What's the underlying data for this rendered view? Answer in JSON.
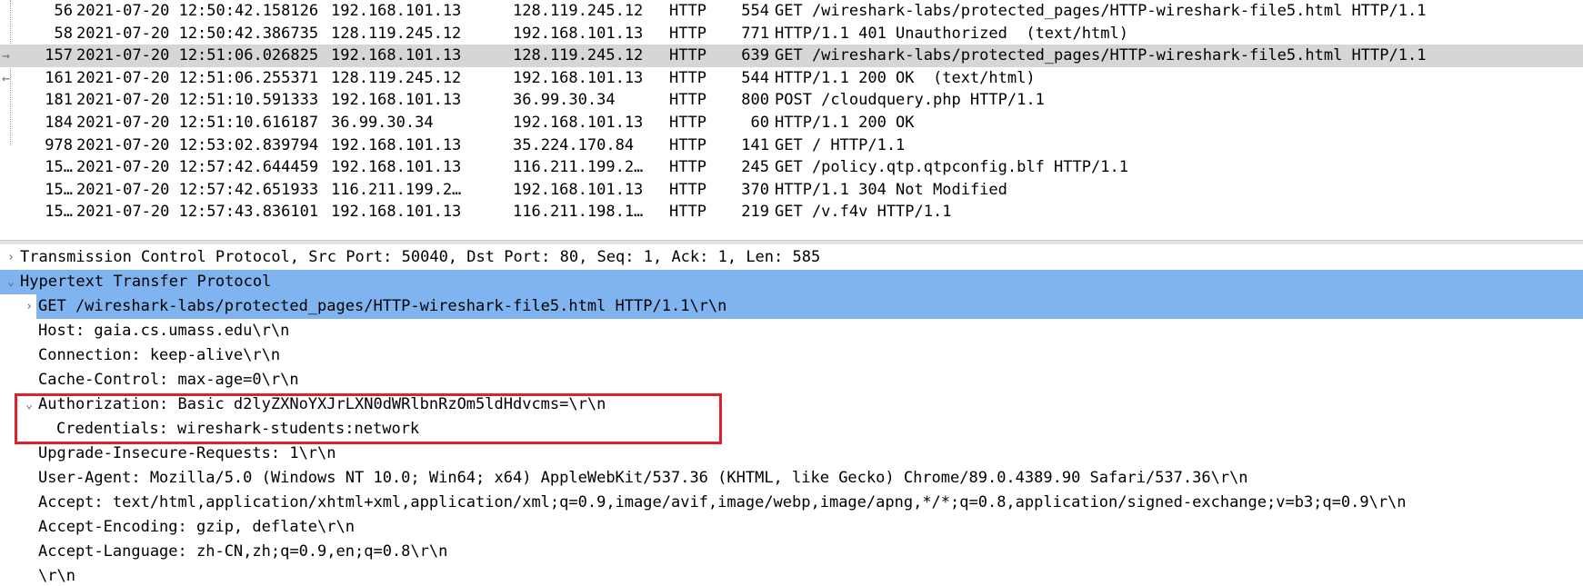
{
  "packet_list": {
    "rows": [
      {
        "no": "56",
        "time": "2021-07-20 12:50:42.158126",
        "src": "192.168.101.13",
        "dst": "128.119.245.12",
        "proto": "HTTP",
        "len": "554",
        "info": "GET /wireshark-labs/protected_pages/HTTP-wireshark-file5.html HTTP/1.1"
      },
      {
        "no": "58",
        "time": "2021-07-20 12:50:42.386735",
        "src": "128.119.245.12",
        "dst": "192.168.101.13",
        "proto": "HTTP",
        "len": "771",
        "info": "HTTP/1.1 401 Unauthorized  (text/html)"
      },
      {
        "no": "157",
        "time": "2021-07-20 12:51:06.026825",
        "src": "192.168.101.13",
        "dst": "128.119.245.12",
        "proto": "HTTP",
        "len": "639",
        "info": "GET /wireshark-labs/protected_pages/HTTP-wireshark-file5.html HTTP/1.1"
      },
      {
        "no": "161",
        "time": "2021-07-20 12:51:06.255371",
        "src": "128.119.245.12",
        "dst": "192.168.101.13",
        "proto": "HTTP",
        "len": "544",
        "info": "HTTP/1.1 200 OK  (text/html)"
      },
      {
        "no": "181",
        "time": "2021-07-20 12:51:10.591333",
        "src": "192.168.101.13",
        "dst": "36.99.30.34",
        "proto": "HTTP",
        "len": "800",
        "info": "POST /cloudquery.php HTTP/1.1"
      },
      {
        "no": "184",
        "time": "2021-07-20 12:51:10.616187",
        "src": "36.99.30.34",
        "dst": "192.168.101.13",
        "proto": "HTTP",
        "len": "60",
        "info": "HTTP/1.1 200 OK"
      },
      {
        "no": "978",
        "time": "2021-07-20 12:53:02.839794",
        "src": "192.168.101.13",
        "dst": "35.224.170.84",
        "proto": "HTTP",
        "len": "141",
        "info": "GET / HTTP/1.1"
      },
      {
        "no": "15…",
        "time": "2021-07-20 12:57:42.644459",
        "src": "192.168.101.13",
        "dst": "116.211.199.2…",
        "proto": "HTTP",
        "len": "245",
        "info": "GET /policy.qtp.qtpconfig.blf HTTP/1.1"
      },
      {
        "no": "15…",
        "time": "2021-07-20 12:57:42.651933",
        "src": "116.211.199.2…",
        "dst": "192.168.101.13",
        "proto": "HTTP",
        "len": "370",
        "info": "HTTP/1.1 304 Not Modified"
      },
      {
        "no": "15…",
        "time": "2021-07-20 12:57:43.836101",
        "src": "192.168.101.13",
        "dst": "116.211.198.1…",
        "proto": "HTTP",
        "len": "219",
        "info": "GET /v.f4v HTTP/1.1"
      }
    ],
    "selected_index": 2
  },
  "details": {
    "rows": [
      {
        "expander": "›",
        "text": "Transmission Control Protocol, Src Port: 50040, Dst Port: 80, Seq: 1, Ack: 1, Len: 585"
      },
      {
        "expander": "⌄",
        "text": "Hypertext Transfer Protocol"
      },
      {
        "expander": "›",
        "text": "GET /wireshark-labs/protected_pages/HTTP-wireshark-file5.html HTTP/1.1\\r\\n"
      },
      {
        "expander": "",
        "text": "Host: gaia.cs.umass.edu\\r\\n"
      },
      {
        "expander": "",
        "text": "Connection: keep-alive\\r\\n"
      },
      {
        "expander": "",
        "text": "Cache-Control: max-age=0\\r\\n"
      },
      {
        "expander": "⌄",
        "text": "Authorization: Basic d2lyZXNoYXJrLXN0dWRlbnRzOm5ldHdvcms=\\r\\n"
      },
      {
        "expander": "",
        "text": "Credentials: wireshark-students:network"
      },
      {
        "expander": "",
        "text": "Upgrade-Insecure-Requests: 1\\r\\n"
      },
      {
        "expander": "",
        "text": "User-Agent: Mozilla/5.0 (Windows NT 10.0; Win64; x64) AppleWebKit/537.36 (KHTML, like Gecko) Chrome/89.0.4389.90 Safari/537.36\\r\\n"
      },
      {
        "expander": "",
        "text": "Accept: text/html,application/xhtml+xml,application/xml;q=0.9,image/avif,image/webp,image/apng,*/*;q=0.8,application/signed-exchange;v=b3;q=0.9\\r\\n"
      },
      {
        "expander": "",
        "text": "Accept-Encoding: gzip, deflate\\r\\n"
      },
      {
        "expander": "",
        "text": "Accept-Language: zh-CN,zh;q=0.9,en;q=0.8\\r\\n"
      },
      {
        "expander": "",
        "text": "\\r\\n"
      }
    ]
  },
  "colors": {
    "selected_packet_bg": "#d6d6d6",
    "selected_detail_bg": "#7fb4f0",
    "highlight_border": "#e0202a"
  }
}
